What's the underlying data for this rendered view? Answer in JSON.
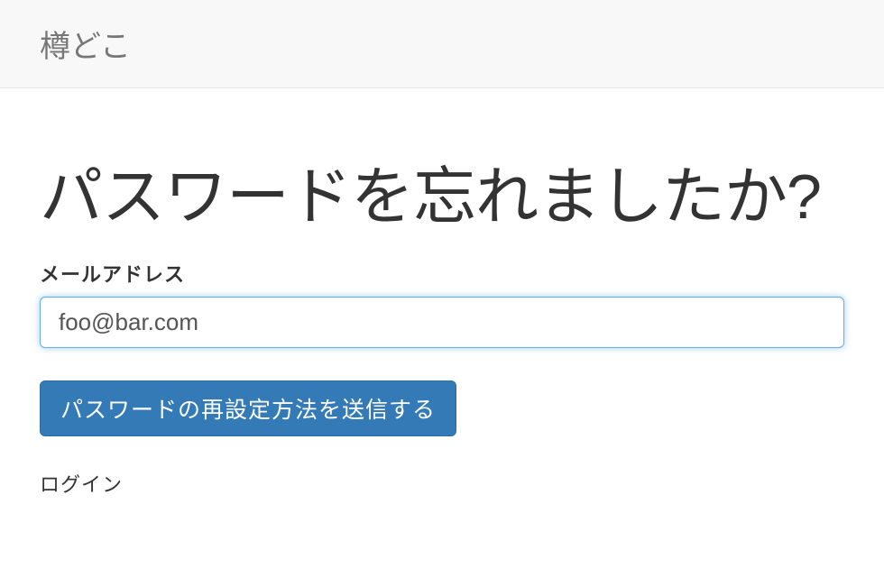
{
  "navbar": {
    "brand": "樽どこ"
  },
  "page": {
    "title": "パスワードを忘れましたか?"
  },
  "form": {
    "email_label": "メールアドレス",
    "email_value": "foo@bar.com",
    "submit_label": "パスワードの再設定方法を送信する"
  },
  "links": {
    "login": "ログイン"
  }
}
